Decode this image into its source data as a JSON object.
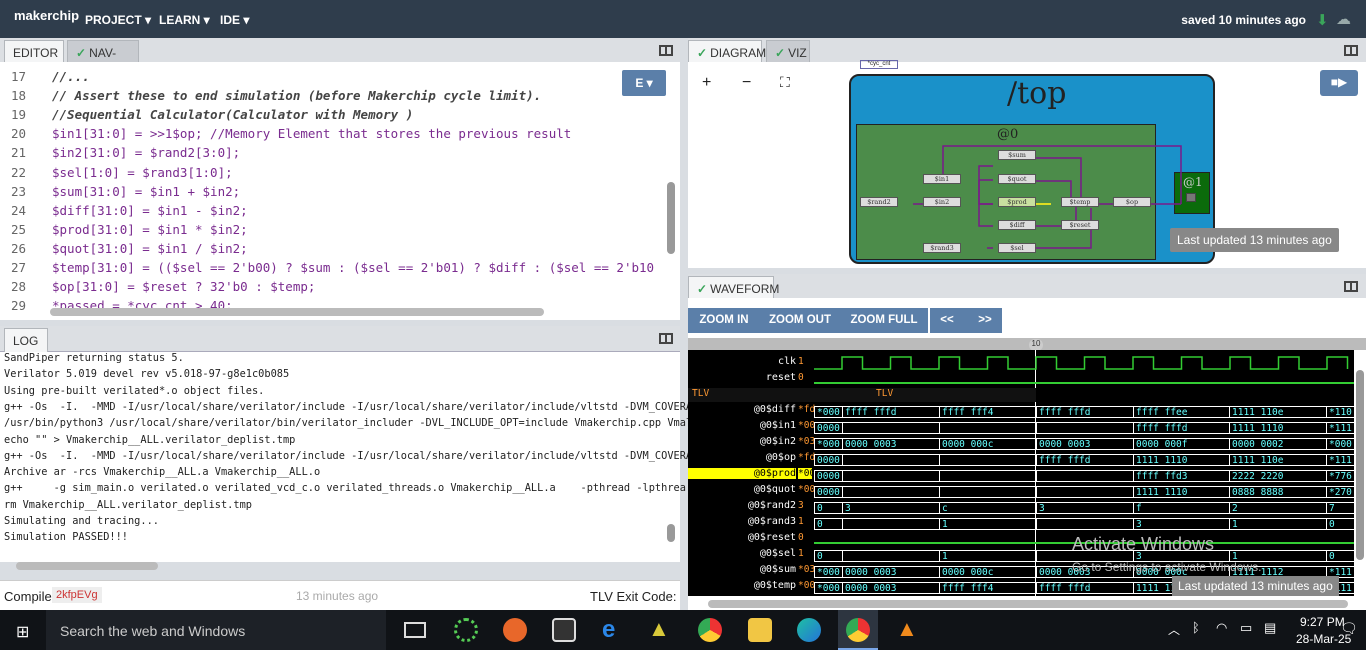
{
  "topbar": {
    "logo": "makerchip",
    "menu": [
      "PROJECT ▾",
      "LEARN ▾",
      "IDE ▾"
    ],
    "saved": "saved 10 minutes ago"
  },
  "editor": {
    "tabs": [
      "EDITOR",
      "NAV-TLV"
    ],
    "dropdown": "E ▾",
    "lines": [
      {
        "n": "17",
        "t": "//..."
      },
      {
        "n": "18",
        "t": "// Assert these to end simulation (before Makerchip cycle limit)."
      },
      {
        "n": "19",
        "t": "//Sequential Calculator(Calculator with Memory )"
      },
      {
        "n": "20",
        "t": "$in1[31:0] = >>1$op; //Memory Element that stores the previous result"
      },
      {
        "n": "21",
        "t": "$in2[31:0] = $rand2[3:0];"
      },
      {
        "n": "22",
        "t": "$sel[1:0] = $rand3[1:0];"
      },
      {
        "n": "23",
        "t": "$sum[31:0] = $in1 + $in2;"
      },
      {
        "n": "24",
        "t": "$diff[31:0] = $in1 - $in2;"
      },
      {
        "n": "25",
        "t": "$prod[31:0] = $in1 * $in2;"
      },
      {
        "n": "26",
        "t": "$quot[31:0] = $in1 / $in2;"
      },
      {
        "n": "27",
        "t": "$temp[31:0] = (($sel == 2'b00) ? $sum : ($sel == 2'b01) ? $diff : ($sel == 2'b10"
      },
      {
        "n": "28",
        "t": "$op[31:0] = $reset ? 32'b0 : $temp;"
      },
      {
        "n": "29",
        "t": "*passed = *cyc_cnt > 40;"
      }
    ]
  },
  "log": {
    "tab": "LOG",
    "lines": [
      "SandPiper returning status 5.",
      "Verilator 5.019 devel rev v5.018-97-g8e1c0b085",
      "Using pre-built verilated*.o object files.",
      "g++ -Os  -I.  -MMD -I/usr/local/share/verilator/include -I/usr/local/share/verilator/include/vltstd -DVM_COVERA",
      "/usr/bin/python3 /usr/local/share/verilator/bin/verilator_includer -DVL_INCLUDE_OPT=include Vmakerchip.cpp Vmal",
      "echo \"\" > Vmakerchip__ALL.verilator_deplist.tmp",
      "g++ -Os  -I.  -MMD -I/usr/local/share/verilator/include -I/usr/local/share/verilator/include/vltstd -DVM_COVERA",
      "Archive ar -rcs Vmakerchip__ALL.a Vmakerchip__ALL.o",
      "g++     -g sim_main.o verilated.o verilated_vcd_c.o verilated_threads.o Vmakerchip__ALL.a    -pthread -lpthrea",
      "rm Vmakerchip__ALL.verilator_deplist.tmp",
      "Simulating and tracing...",
      "Simulation PASSED!!!"
    ]
  },
  "status": {
    "compile": "Compile",
    "id": "2kfpEVg",
    "ago": "13 minutes ago",
    "exit": "TLV Exit Code:"
  },
  "diagram": {
    "tabs": [
      "DIAGRAM",
      "VIZ"
    ],
    "top": "/top",
    "stage0": "@0",
    "stage1": "@1",
    "cyc": "*cyc_cnt",
    "updated": "Last updated 13 minutes ago",
    "nodes": [
      "$sum",
      "$in1",
      "$quot",
      "$rand2",
      "$in2",
      "$prod",
      "$temp",
      "$op",
      "$diff",
      "$reset",
      "$rand3",
      "$sel"
    ]
  },
  "waveform": {
    "tab": "WAVEFORM",
    "buttons": [
      "ZOOM IN",
      "ZOOM OUT",
      "ZOOM FULL",
      "<<",
      ">>"
    ],
    "marker": "10",
    "tlv": "TLV",
    "updated": "Last updated 13 minutes ago",
    "watermark1": "Activate Windows",
    "watermark2": "Go to Settings to activate Windows.",
    "rows": [
      {
        "name": "clk",
        "v": "1",
        "cells": []
      },
      {
        "name": "reset",
        "v": "0",
        "cells": []
      },
      {
        "name": "@0$diff",
        "v": "*fd",
        "cells": [
          "*000",
          "ffff_fffd",
          "ffff_fff4",
          "ffff_fffd",
          "ffff_ffee",
          "1111_110e",
          "*110"
        ]
      },
      {
        "name": "@0$in1",
        "v": "*00",
        "cells": [
          "0000_0000",
          "",
          "",
          "",
          "ffff_fffd",
          "1111_1110",
          "*111"
        ]
      },
      {
        "name": "@0$in2",
        "v": "*03",
        "cells": [
          "*000",
          "0000_0003",
          "0000_000c",
          "0000_0003",
          "0000_000f",
          "0000_0002",
          "*000"
        ]
      },
      {
        "name": "@0$op",
        "v": "*fd",
        "cells": [
          "0000_0000",
          "",
          "",
          "ffff_fffd",
          "1111_1110",
          "1111_110e",
          "*111"
        ]
      },
      {
        "name": "@0$prod",
        "v": "*00",
        "cells": [
          "0000_0000",
          "",
          "",
          "",
          "ffff_ffd3",
          "2222_2220",
          "*776"
        ]
      },
      {
        "name": "@0$quot",
        "v": "*00",
        "cells": [
          "0000_0000",
          "",
          "",
          "",
          "1111_1110",
          "0888_8888",
          "*270"
        ]
      },
      {
        "name": "@0$rand2",
        "v": "3",
        "cells": [
          "0",
          "3",
          "c",
          "3",
          "f",
          "2",
          "7"
        ]
      },
      {
        "name": "@0$rand3",
        "v": "1",
        "cells": [
          "0",
          "",
          "1",
          "",
          "3",
          "1",
          "0"
        ]
      },
      {
        "name": "@0$reset",
        "v": "0",
        "cells": []
      },
      {
        "name": "@0$sel",
        "v": "1",
        "cells": [
          "0",
          "",
          "1",
          "",
          "3",
          "1",
          "0"
        ]
      },
      {
        "name": "@0$sum",
        "v": "*03",
        "cells": [
          "*000",
          "0000_0003",
          "0000_000c",
          "0000_0003",
          "0000_000c",
          "1111_1112",
          "*111"
        ]
      },
      {
        "name": "@0$temp",
        "v": "*00",
        "cells": [
          "*000",
          "0000_0003",
          "ffff_fff4",
          "ffff_fffd",
          "1111_1110",
          "1111_110e",
          "*111"
        ]
      }
    ]
  },
  "taskbar": {
    "search": "Search the web and Windows",
    "time": "9:27 PM",
    "date": "28-Mar-25"
  }
}
